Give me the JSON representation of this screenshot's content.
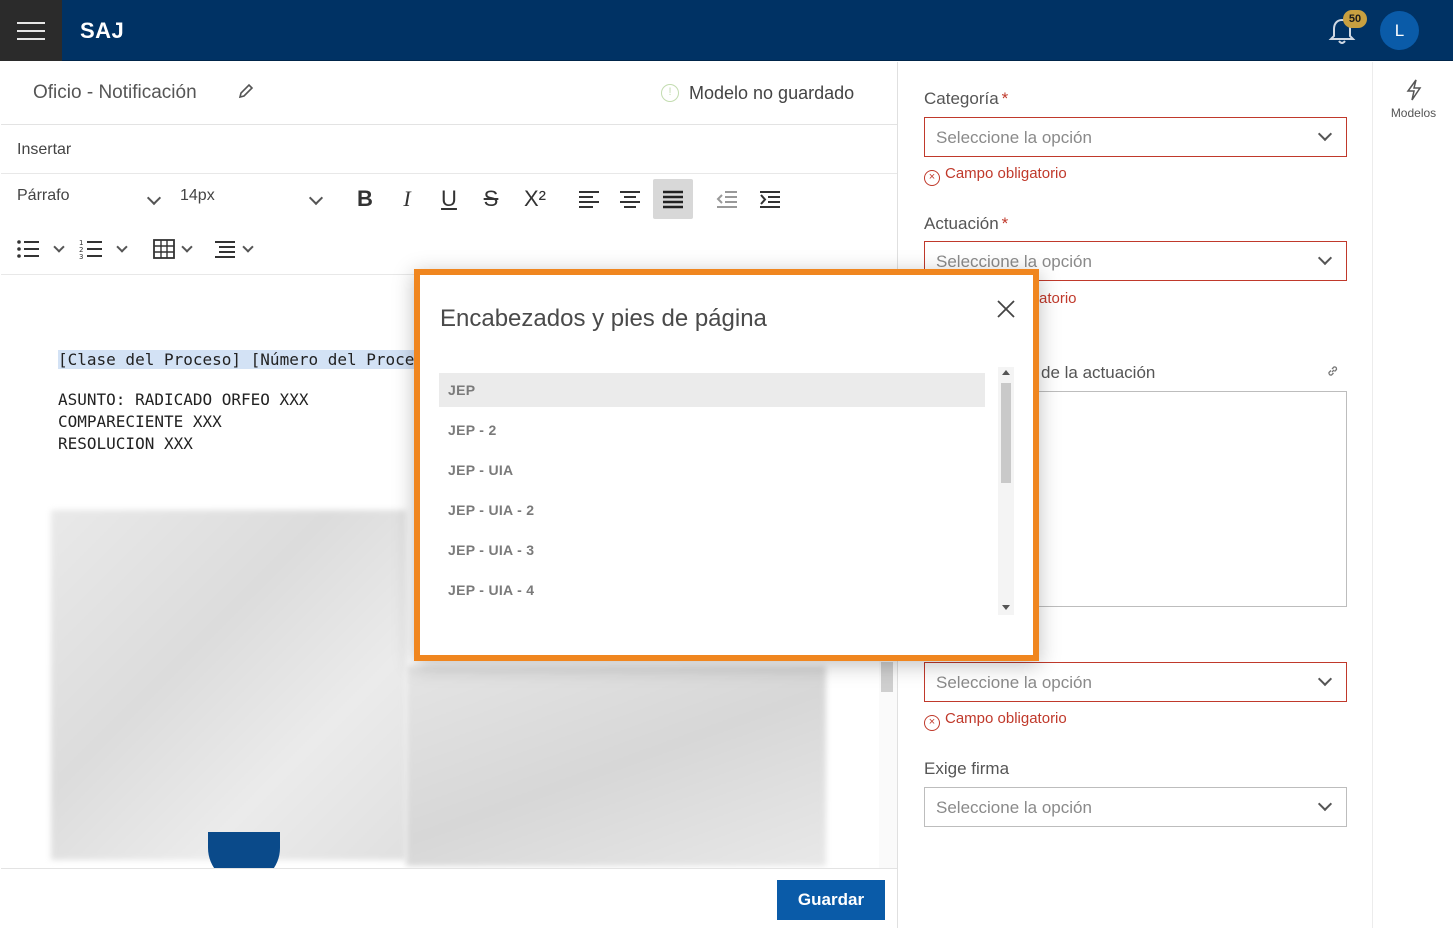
{
  "topbar": {
    "brand": "SAJ",
    "notification_count": "50",
    "avatar_initial": "L"
  },
  "editor": {
    "title": "Oficio - Notificación",
    "status_text": "Modelo no guardado",
    "insert_label": "Insertar",
    "paragraph_style": "Párrafo",
    "font_size": "14px",
    "superscript_label": "X²",
    "doc_lines": {
      "line1_a": "[Clase del Proceso]",
      "line1_b": " [Número del Proceso",
      "line2": "ASUNTO: RADICADO ORFEO XXX",
      "line3": "COMPARECIENTE XXX",
      "line4": "RESOLUCION XXX"
    },
    "save_label": "Guardar"
  },
  "form": {
    "categoria_label": "Categoría",
    "actuacion_label": "Actuación",
    "descripcion_label_visible": "de la actuación",
    "exige_firma_label": "Exige firma",
    "required_mark": "*",
    "placeholder": "Seleccione la opción",
    "error_text": "Campo obligatorio",
    "error_text_partial": "atorio"
  },
  "rail": {
    "models_label": "Modelos"
  },
  "modal": {
    "title": "Encabezados y pies de página",
    "items": [
      "JEP",
      "JEP - 2",
      "JEP - UIA",
      "JEP - UIA - 2",
      "JEP - UIA - 3",
      "JEP - UIA - 4"
    ],
    "selected_index": 0
  },
  "colors": {
    "topbar": "#003264",
    "accent_orange": "#f0861f",
    "primary_button": "#0a5ba8",
    "error_red": "#c0392b"
  }
}
